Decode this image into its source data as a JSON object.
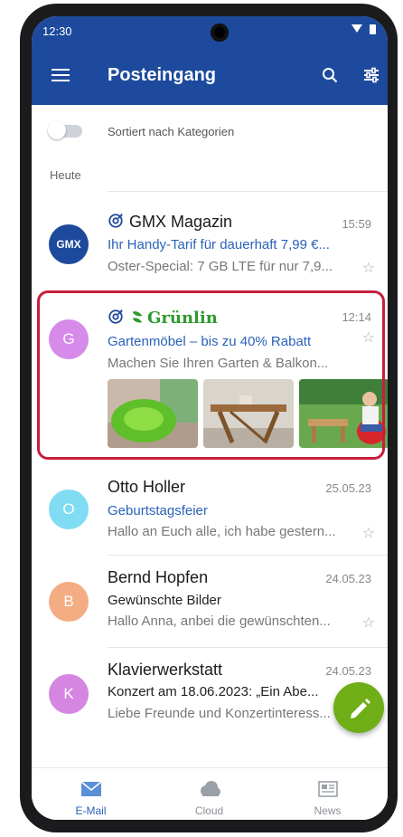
{
  "status_bar": {
    "time": "12:30"
  },
  "app_bar": {
    "title": "Posteingang"
  },
  "sort": {
    "label": "Sortiert nach Kategorien",
    "enabled": false
  },
  "section": {
    "today_label": "Heute"
  },
  "emails": [
    {
      "sender": "GMX Magazin",
      "time": "15:59",
      "subject": "Ihr Handy-Tarif für dauerhaft 7,99 €...",
      "preview": "Oster-Special: 7 GB LTE für nur 7,9...",
      "avatar_label": "GMX",
      "avatar_color": "#1d4a9c",
      "ad": true
    },
    {
      "sender": "Grünlin",
      "time": "12:14",
      "subject": "Gartenmöbel – bis zu 40% Rabatt",
      "preview": "Machen Sie Ihren Garten & Balkon...",
      "avatar_label": "G",
      "avatar_color": "#d68bea",
      "ad": true
    },
    {
      "sender": "Otto Holler",
      "time": "25.05.23",
      "subject": "Geburtstagsfeier",
      "preview": "Hallo an Euch alle, ich habe gestern...",
      "avatar_label": "O",
      "avatar_color": "#7fdcf2"
    },
    {
      "sender": "Bernd Hopfen",
      "time": "24.05.23",
      "subject": "Gewünschte Bilder",
      "preview": "Hallo Anna, anbei die gewünschten...",
      "avatar_label": "B",
      "avatar_color": "#f4ad82"
    },
    {
      "sender": "Klavierwerkstatt",
      "time": "24.05.23",
      "subject": "Konzert am 18.06.2023: „Ein Abe...",
      "preview": "Liebe Freunde und Konzertinteress...",
      "avatar_label": "K",
      "avatar_color": "#d486e0"
    }
  ],
  "star_glyph": "☆",
  "bottom_nav": {
    "email": "E-Mail",
    "cloud": "Cloud",
    "news": "News"
  },
  "colors": {
    "brand": "#1d4a9c",
    "accent": "#2a62b8",
    "fab": "#6fae16",
    "highlight": "#c81e3b",
    "greenlin": "#2f9a2c"
  },
  "icons": [
    "menu-icon",
    "search-icon",
    "filter-icon",
    "mail-icon",
    "cloud-icon",
    "news-icon",
    "pencil-icon",
    "star-icon",
    "at-icon"
  ]
}
